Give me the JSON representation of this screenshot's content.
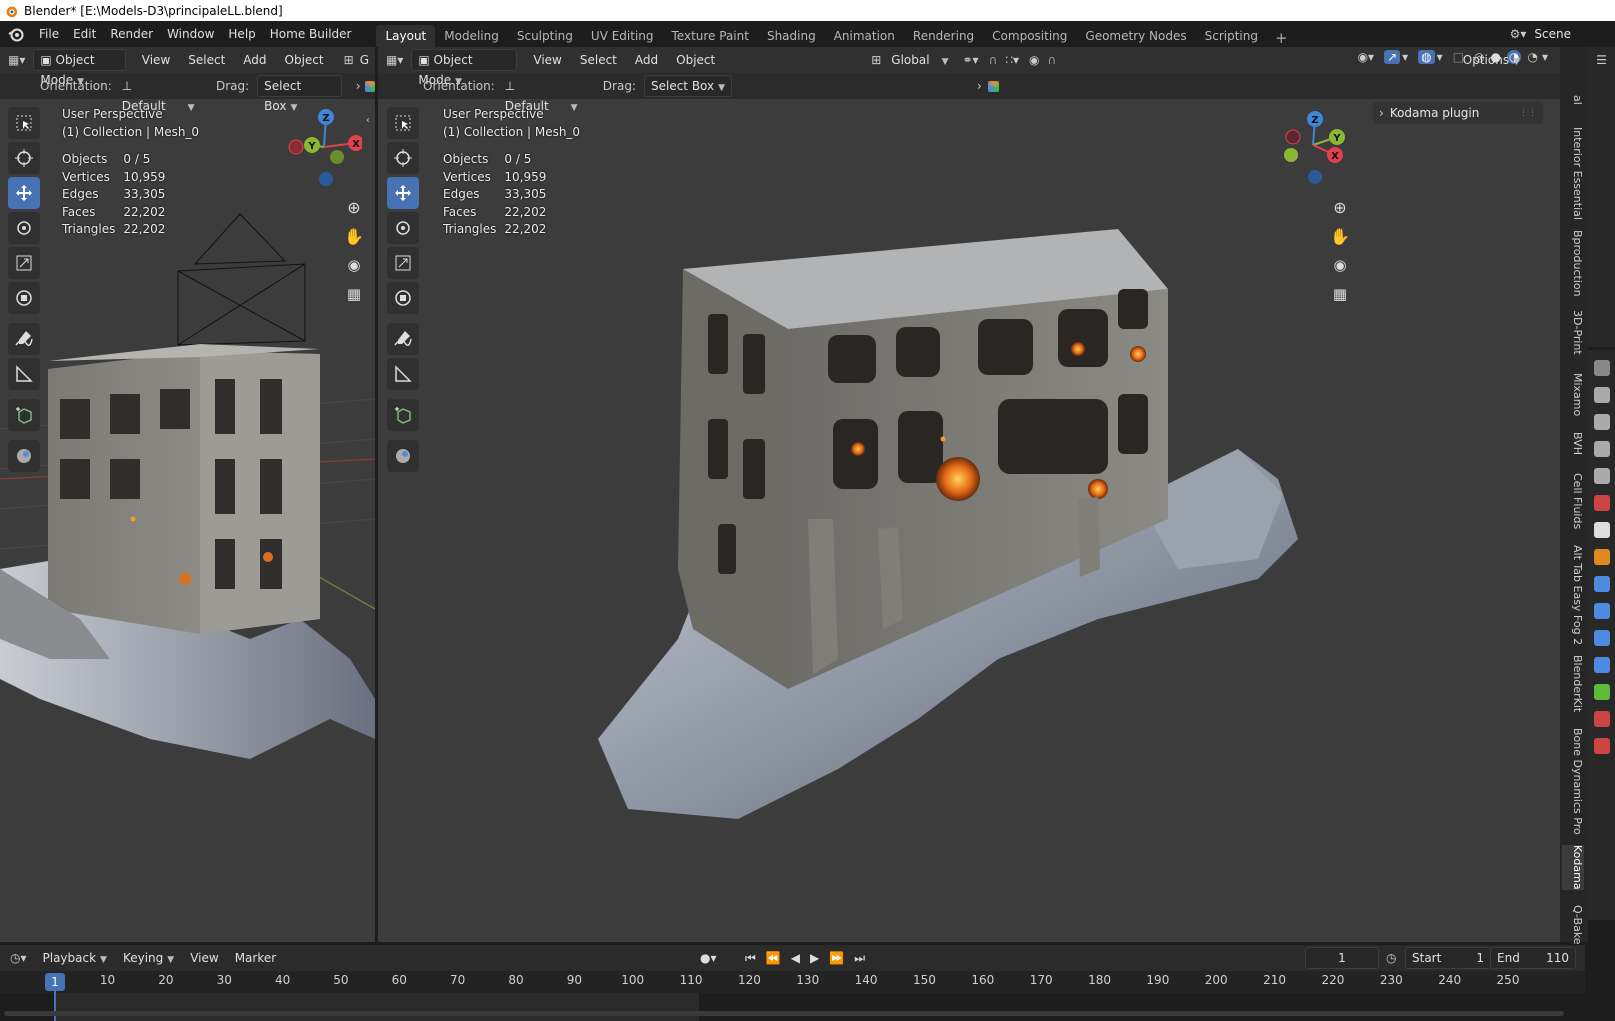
{
  "window": {
    "title": "Blender* [E:\\Models-D3\\principaleLL.blend]"
  },
  "menu": [
    "File",
    "Edit",
    "Render",
    "Window",
    "Help",
    "Home Builder"
  ],
  "workspaces": [
    {
      "label": "Layout",
      "active": true
    },
    {
      "label": "Modeling"
    },
    {
      "label": "Sculpting"
    },
    {
      "label": "UV Editing"
    },
    {
      "label": "Texture Paint"
    },
    {
      "label": "Shading"
    },
    {
      "label": "Animation"
    },
    {
      "label": "Rendering"
    },
    {
      "label": "Compositing"
    },
    {
      "label": "Geometry Nodes"
    },
    {
      "label": "Scripting"
    }
  ],
  "scene": {
    "label": "Scene"
  },
  "left_viewport": {
    "mode": "Object Mode",
    "menu": [
      "View",
      "Select",
      "Add",
      "Object"
    ],
    "transform_cut": "G",
    "orientation_label": "Orientation:",
    "orientation_value": "Default",
    "drag_label": "Drag:",
    "drag_value": "Select Box",
    "perspective": "User Perspective",
    "collection": "(1) Collection | Mesh_0",
    "stats": [
      {
        "k": "Objects",
        "v": "0 / 5"
      },
      {
        "k": "Vertices",
        "v": "10,959"
      },
      {
        "k": "Edges",
        "v": "33,305"
      },
      {
        "k": "Faces",
        "v": "22,202"
      },
      {
        "k": "Triangles",
        "v": "22,202"
      }
    ]
  },
  "main_viewport": {
    "mode": "Object Mode",
    "menu": [
      "View",
      "Select",
      "Add",
      "Object"
    ],
    "transform_orientation": "Global",
    "orientation_label": "Orientation:",
    "orientation_value": "Default",
    "drag_label": "Drag:",
    "drag_value": "Select Box",
    "options": "Options",
    "perspective": "User Perspective",
    "collection": "(1) Collection | Mesh_0",
    "stats": [
      {
        "k": "Objects",
        "v": "0 / 5"
      },
      {
        "k": "Vertices",
        "v": "10,959"
      },
      {
        "k": "Edges",
        "v": "33,305"
      },
      {
        "k": "Faces",
        "v": "22,202"
      },
      {
        "k": "Triangles",
        "v": "22,202"
      }
    ],
    "plugin_panel": "Kodama plugin"
  },
  "gizmo": {
    "z": "Z",
    "y": "Y",
    "x": "X"
  },
  "sidebar_tabs": [
    "al",
    "Interior Essential",
    "Bproduction",
    "3D-Print",
    "Mixamo",
    "BVH",
    "Cell Fluids",
    "Alt Tab Easy Fog 2",
    "BlenderKit",
    "Bone Dynamics Pro",
    "Kodama",
    "Q-Bake"
  ],
  "timeline": {
    "menu": [
      "Playback",
      "Keying",
      "View",
      "Marker"
    ],
    "current_frame": "1",
    "start_label": "Start",
    "start": "1",
    "end_label": "End",
    "end": "110",
    "ticks": [
      "1",
      "10",
      "20",
      "30",
      "40",
      "50",
      "60",
      "70",
      "80",
      "90",
      "100",
      "110",
      "120",
      "130",
      "140",
      "150",
      "160",
      "170",
      "180",
      "190",
      "200",
      "210",
      "220",
      "230",
      "240",
      "250"
    ]
  },
  "colors": {
    "accent": "#4772b3",
    "x_axis": "#e2404d",
    "y_axis": "#8bb735",
    "z_axis": "#3e86d8"
  }
}
